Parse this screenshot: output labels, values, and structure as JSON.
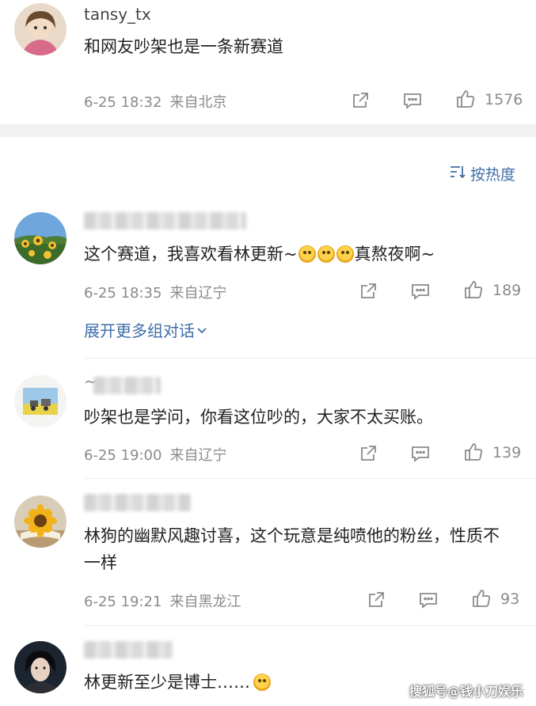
{
  "top_comment": {
    "username": "tansy_tx",
    "text": "和网友吵架也是一条新赛道",
    "date": "6-25 18:32",
    "location": "来自北京",
    "likes": "1576"
  },
  "sort": {
    "label": "按热度"
  },
  "comments": [
    {
      "text_before": "这个赛道，我喜欢看林更新~",
      "text_after": "真熬夜啊~",
      "date": "6-25 18:35",
      "location": "来自辽宁",
      "likes": "189",
      "expand_label": "展开更多组对话"
    },
    {
      "username_prefix": "~",
      "text": "吵架也是学问，你看这位吵的，大家不太买账。",
      "date": "6-25 19:00",
      "location": "来自辽宁",
      "likes": "139"
    },
    {
      "text": "林狗的幽默风趣讨喜，这个玩意是纯喷他的粉丝，性质不一样",
      "date": "6-25 19:21",
      "location": "来自黑龙江",
      "likes": "93"
    },
    {
      "text": "林更新至少是博士……"
    }
  ],
  "watermark": "搜狐号@钱小刀娱乐",
  "colors": {
    "link_blue": "#3f6ea8",
    "meta_gray": "#8a8a8a",
    "divider": "#f1f1f1"
  },
  "icons": [
    "share-icon",
    "comment-icon",
    "like-icon",
    "sort-icon",
    "chevron-down-icon"
  ]
}
